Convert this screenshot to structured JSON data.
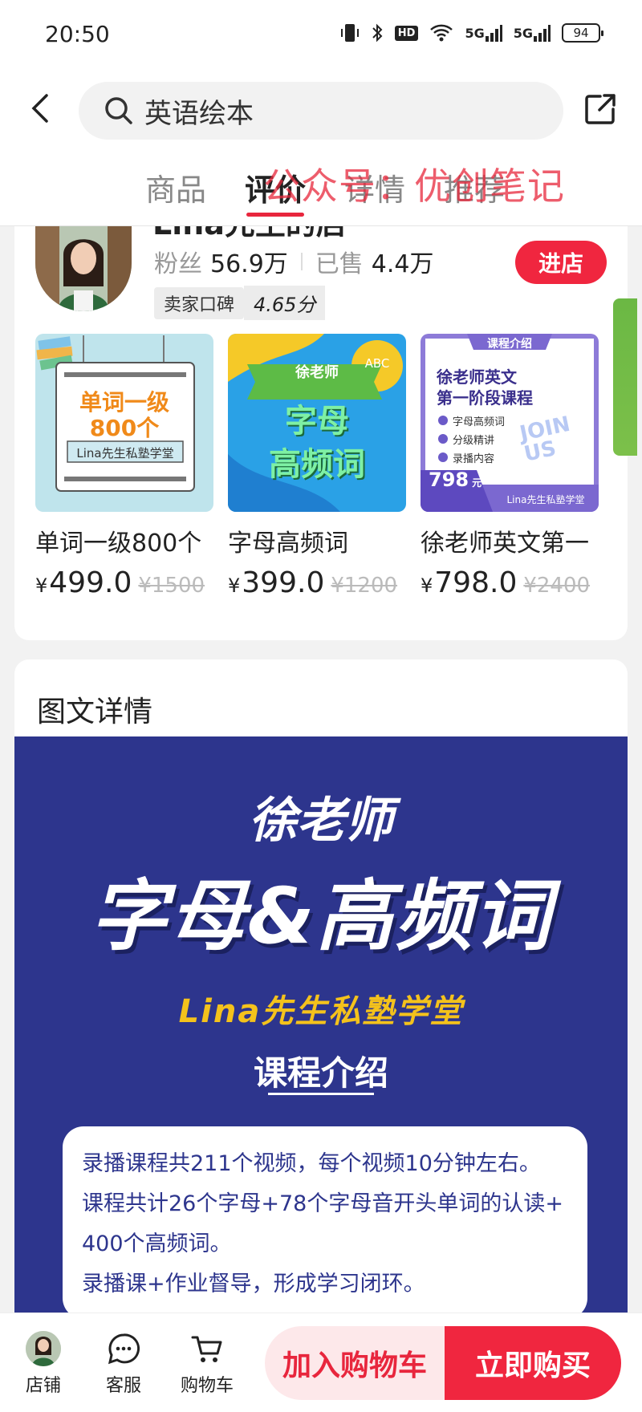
{
  "status_bar": {
    "time": "20:50",
    "battery": "94",
    "hd": "HD",
    "net1": "5G",
    "net2": "5G"
  },
  "header": {
    "search_text": "英语绘本"
  },
  "tabs": [
    {
      "label": "商品"
    },
    {
      "label": "评价"
    },
    {
      "label": "详情"
    },
    {
      "label": "推荐"
    }
  ],
  "watermark": "公众号：优创笔记",
  "shop": {
    "name": "Lina先生的店",
    "fans_label": "粉丝",
    "fans_value": "56.9万",
    "sold_label": "已售",
    "sold_value": "4.4万",
    "rating_label": "卖家口碑",
    "rating_value": "4.65分",
    "enter_label": "进店"
  },
  "products": [
    {
      "title": "单词一级800个",
      "yen": "¥",
      "price": "499.0",
      "orig_price": "¥1500",
      "img_line1": "单词一级",
      "img_line2": "800个",
      "img_sub": "Lina先生私塾学堂"
    },
    {
      "title": "字母高频词",
      "yen": "¥",
      "price": "399.0",
      "orig_price": "¥1200",
      "img_ribbon": "徐老师",
      "img_badge": "ABC",
      "img_line1": "字母",
      "img_line2": "高频词"
    },
    {
      "title": "徐老师英文第一",
      "yen": "¥",
      "price": "798.0",
      "orig_price": "¥2400",
      "img_tag": "课程介绍",
      "img_line1": "徐老师英文",
      "img_line2": "第一阶段课程",
      "img_bullets": [
        "字母高频词",
        "分级精讲",
        "录播内容"
      ],
      "img_join": "JOIN US",
      "img_price": "798",
      "img_price_unit": "元",
      "img_footer": "Lina先生私塾学堂"
    }
  ],
  "detail": {
    "title": "图文详情",
    "banner_teacher": "徐老师",
    "banner_main": "字母&高频词",
    "banner_school": "Lina先生私塾学堂",
    "banner_intro": "课程介绍",
    "intro_lines": [
      "录播课程共211个视频，每个视频10分钟左右。",
      "课程共计26个字母+78个字母音开头单词的认读+",
      "400个高频词。",
      "录播课+作业督导，形成学习闭环。"
    ]
  },
  "bottom_bar": {
    "shop_label": "店铺",
    "service_label": "客服",
    "cart_label": "购物车",
    "add_cart_label": "加入购物车",
    "buy_label": "立即购买"
  },
  "colors": {
    "accent": "#f0263f",
    "banner": "#2d358d",
    "gold": "#f4c21c"
  }
}
